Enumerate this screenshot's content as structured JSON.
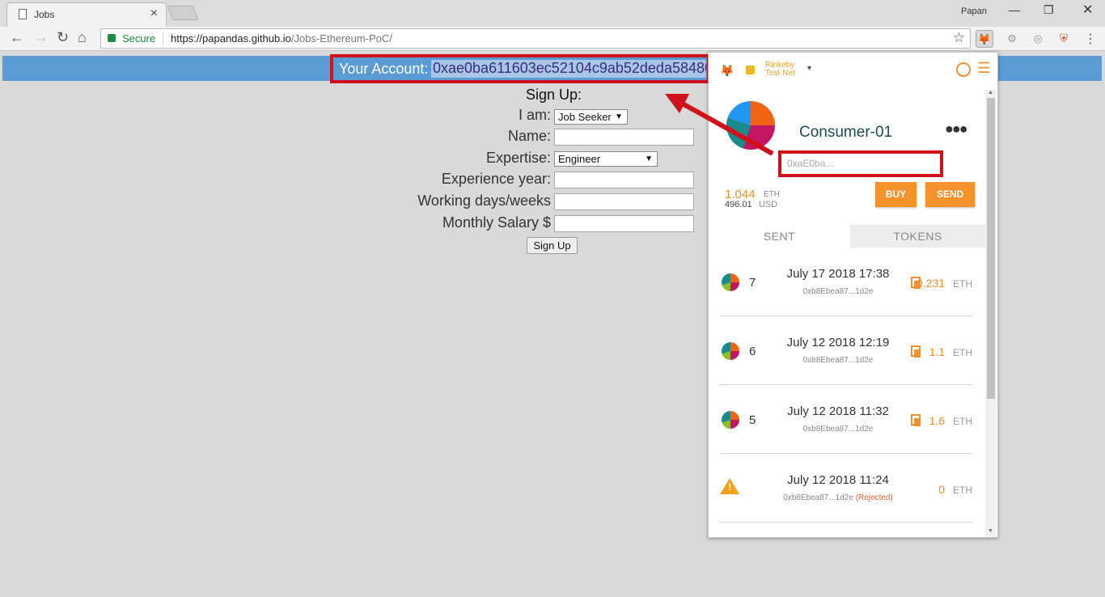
{
  "browser": {
    "tab_title": "Jobs",
    "profile": "Papan",
    "secure_label": "Secure",
    "url_host": "https://papandas.github.io",
    "url_path": "/Jobs-Ethereum-PoC/"
  },
  "account_bar": {
    "label": "Your Account:",
    "value": "0xae0ba611603ec52104c9ab52deda58480"
  },
  "form": {
    "title": "Sign Up:",
    "i_am_label": "I am:",
    "i_am_value": "Job Seeker",
    "name_label": "Name:",
    "expertise_label": "Expertise:",
    "expertise_value": "Engineer",
    "experience_label": "Experience year:",
    "working_days_label": "Working days/weeks",
    "salary_label": "Monthly Salary $",
    "submit_label": "Sign Up"
  },
  "metamask": {
    "network_line1": "Rinkeby",
    "network_line2": "Test Net",
    "account_name": "Consumer-01",
    "address_short": "0xaE0ba...",
    "balance_eth": "1.044",
    "balance_eth_unit": "ETH",
    "balance_usd": "496.01",
    "balance_usd_unit": "USD",
    "buy_label": "BUY",
    "send_label": "SEND",
    "tabs": [
      "SENT",
      "TOKENS"
    ],
    "transactions": [
      {
        "nonce": "7",
        "date": "July 17 2018 17:38",
        "address": "0xb8Ebea87...1d2e",
        "status": "",
        "value": "0.231",
        "unit": "ETH"
      },
      {
        "nonce": "6",
        "date": "July 12 2018 12:19",
        "address": "0xb8Ebea87...1d2e",
        "status": "",
        "value": "1.1",
        "unit": "ETH"
      },
      {
        "nonce": "5",
        "date": "July 12 2018 11:32",
        "address": "0xb8Ebea87...1d2e",
        "status": "",
        "value": "1.6",
        "unit": "ETH"
      },
      {
        "nonce": "",
        "date": "July 12 2018 11:24",
        "address": "0xb8Ebea87...1d2e",
        "status": "(Rejected)",
        "value": "0",
        "unit": "ETH"
      }
    ]
  },
  "colors": {
    "account_bar": "#5b9bd5",
    "highlight": "#d0101a",
    "metamask_orange": "#f5922a"
  }
}
